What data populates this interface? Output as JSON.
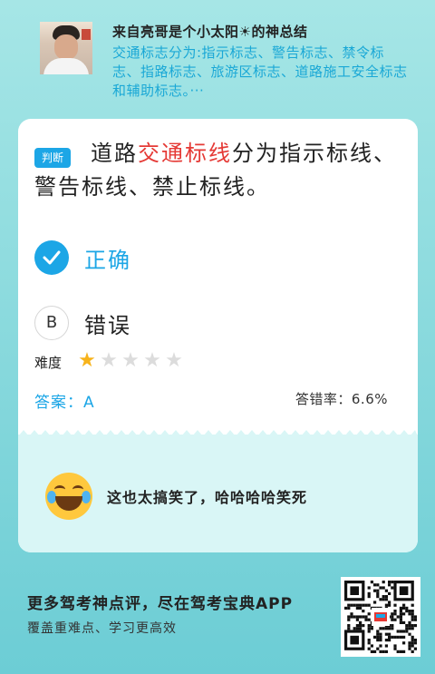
{
  "header": {
    "author": "来自亮哥是个小太阳☀的神总结",
    "summary": "交通标志分为:指示标志、警告标志、禁令标志、指路标志、旅游区标志、道路施工安全标志和辅助标志。···"
  },
  "question": {
    "type_badge": "判断",
    "text_before": "道路",
    "text_highlight": "交通标线",
    "text_after": "分为指示标线、警告标线、禁止标线。"
  },
  "options": [
    {
      "key": "A",
      "label": "正确",
      "selected": true,
      "icon": "check-icon"
    },
    {
      "key": "B",
      "label": "错误",
      "selected": false
    }
  ],
  "difficulty": {
    "label": "难度",
    "rating": 1,
    "max": 5
  },
  "answer": {
    "text": "答案：A"
  },
  "error_rate": {
    "text": "答错率：6.6%"
  },
  "comment": {
    "icon": "rofl-emoji-icon",
    "text": "这也太搞笑了，哈哈哈哈笑死"
  },
  "promo": {
    "title": "更多驾考神点评，尽在驾考宝典APP",
    "subtitle": "覆盖重难点、学习更高效"
  },
  "colors": {
    "accent": "#1ca6e6",
    "highlight": "#e53935",
    "star": "#f7b31b"
  }
}
